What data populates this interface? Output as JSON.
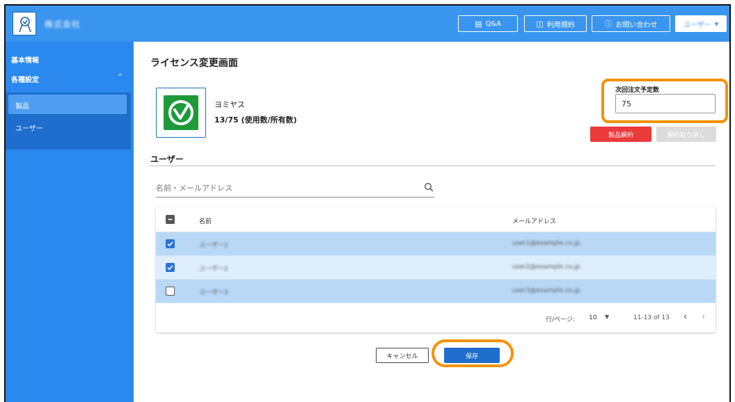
{
  "header": {
    "company": "株式会社",
    "qa_label": "Q&A",
    "terms_label": "利用規約",
    "contact_label": "お問い合わせ",
    "user_label": "ユーザー"
  },
  "sidebar": {
    "items": [
      {
        "label": "基本情報"
      },
      {
        "label": "各種設定"
      },
      {
        "label": "製品"
      },
      {
        "label": "ユーザー"
      }
    ]
  },
  "main": {
    "title": "ライセンス変更画面",
    "product": {
      "name": "ヨミヤス",
      "usage": "13/75 (使用数/所有数)"
    },
    "next_order": {
      "label": "次回注文予定数",
      "value": "75"
    },
    "cancel_license_label": "製品解約",
    "undo_cancel_label": "解約取り消し",
    "users_heading": "ユーザー",
    "search": {
      "placeholder": "名前・メールアドレス"
    },
    "table": {
      "headers": [
        "名前",
        "メールアドレス"
      ],
      "rows": [
        {
          "name": "ユーザー1",
          "email": "user1@example.co.jp",
          "checked": true
        },
        {
          "name": "ユーザー2",
          "email": "user2@example.co.jp",
          "checked": true
        },
        {
          "name": "ユーザー3",
          "email": "user3@example.co.jp",
          "checked": false
        }
      ]
    },
    "pagination": {
      "rows_per_page_label": "行/ページ:",
      "rows_per_page_value": "10",
      "range": "11-13 of 13"
    },
    "cancel_label": "キャンセル",
    "save_label": "保存"
  },
  "colors": {
    "header_bg": "#3a95ee",
    "sidebar_bg": "#2b88ee",
    "highlight": "#f39200",
    "danger": "#ea3a3a",
    "primary": "#1f6dcc"
  }
}
